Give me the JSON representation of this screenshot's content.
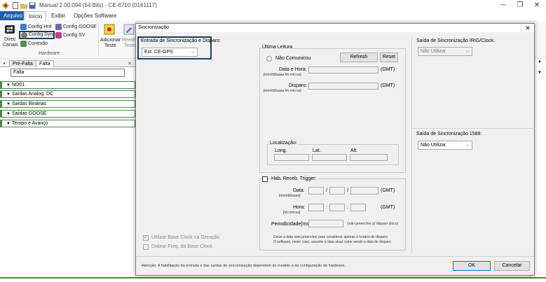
{
  "window": {
    "title": "Manual 2.00.094 (64 Bits) - CE-6710 (0161117)"
  },
  "menu": [
    {
      "label": "Arquivo"
    },
    {
      "label": "Início"
    },
    {
      "label": "Exibir"
    },
    {
      "label": "Opções Software"
    }
  ],
  "ribbon": {
    "direc_label_1": "Direc",
    "direc_label_2": "Canais",
    "config_hrd": "Config Hrd",
    "config_sync": "Config Sync",
    "conexao": "Conexão",
    "config_goose": "Config GOOSE",
    "config_sv": "Config SV",
    "group_hardware": "Hardware",
    "adicionar_1": "Adicionar",
    "adicionar_2": "Teste",
    "reeditar_1": "Reedit",
    "reeditar_2": "Teste"
  },
  "left": {
    "tabs": [
      {
        "label": "Pré-Falta"
      },
      {
        "label": "Falta"
      }
    ],
    "name_value": "Falta",
    "tree": [
      {
        "label": "NO01"
      },
      {
        "label": "Saídas Analog. DC"
      },
      {
        "label": "Saídas Binárias"
      },
      {
        "label": "Saídas GOOSE"
      },
      {
        "label": "Tempo e Avanço"
      }
    ]
  },
  "dialog": {
    "title": "Sincronização",
    "close_glyph": "✕",
    "entrada_label": "Entrada de Sincronização e Disparo:",
    "entrada_value": "Ext: CE-GPS",
    "ultima_leitura": "Última Leitura",
    "nao_comunicou": "Não Comunicou",
    "refresh": "Refresh",
    "reset": "Reset",
    "data_hora": "Data e Hora:",
    "data_hora_fmt": "[mm/dd/aaaa hh:mm:ss]",
    "disparo": "Disparo:",
    "disparo_fmt": "[mm/dd/aaaa hh:mm:ss]",
    "gmt": "(GMT)",
    "localizacao": "Localização:",
    "long": "Long.",
    "lat": "Lat.",
    "alt": "Alt.",
    "hab_trigger": "Hab. Receb. Trigger:",
    "data": "Data:",
    "data_fmt": "[mm/dd/aaaa]",
    "hora": "Hora:",
    "hora_fmt": "[hh:mm:ss]",
    "periodicidade": "Periodicidade[ms]",
    "nao_preencher": "(não preencher p/ disparo único)",
    "info_1": "Deixe a data sem preencher para considerar apenas o horário de disparo.",
    "info_2": "O software, neste caso, assume a data atual como sendo a data de disparo.",
    "saida_irig_label": "Saída de Sincronização IRIG/Clock:",
    "saida_irig_value": "Não Utilizar",
    "saida_1588_label": "Saída de Sincronização 1588:",
    "saida_1588_value": "Não Utilizar",
    "base_clock": "Utilizar Base Clock na Geração",
    "dobrar_freq": "Dobrar Freq. da Base Clock",
    "atencao": "Atenção: A habilitação da entrada e das saídas de sincronização dependem do modelo e da configuração do hardware.",
    "ok": "OK",
    "cancelar": "Cancelar"
  },
  "colors": {
    "accent": "#1f5fa8",
    "highlight": "#1c3f5a",
    "tree_border": "#4a8a4a"
  }
}
